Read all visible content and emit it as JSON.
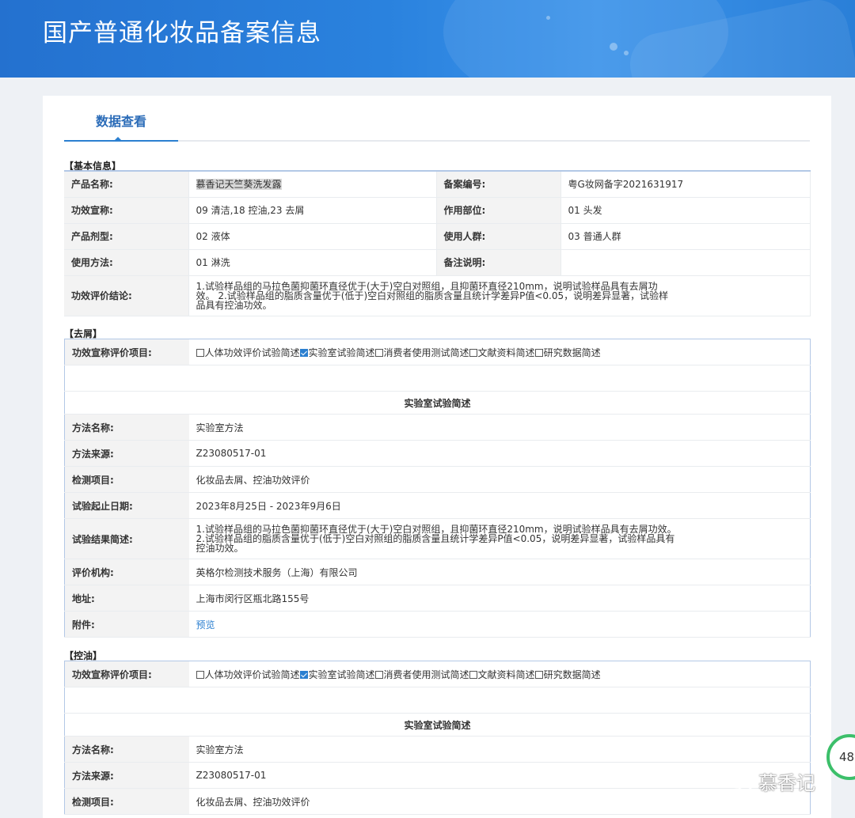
{
  "header": {
    "title": "国产普通化妆品备案信息"
  },
  "tabs": [
    {
      "label": "数据查看",
      "active": true
    }
  ],
  "basic": {
    "section_label": "【基本信息】",
    "rows": [
      {
        "l1": "产品名称:",
        "v1": "慕香记天竺葵洗发露",
        "l2": "备案编号:",
        "v2": "粤G妆网备字2021631917"
      },
      {
        "l1": "功效宣称:",
        "v1": "09 清洁,18 控油,23 去屑",
        "l2": "作用部位:",
        "v2": "01 头发"
      },
      {
        "l1": "产品剂型:",
        "v1": "02 液体",
        "l2": "使用人群:",
        "v2": "03 普通人群"
      },
      {
        "l1": "使用方法:",
        "v1": "01 淋洗",
        "l2": "备注说明:",
        "v2": ""
      }
    ],
    "conclusion_label": "功效评价结论:",
    "conclusion_value": "1.试验样品组的马拉色菌抑菌环直径优于(大于)空白对照组，且抑菌环直径210mm，说明试验样品具有去屑功效。 2.试验样品组的脂质含量优于(低于)空白对照组的脂质含量且统计学差异P值<0.05，说明差异显著，试验样品具有控油功效。"
  },
  "sections": [
    {
      "label": "【去屑】",
      "eval_label": "功效宣称评价项目:",
      "options": [
        {
          "text": "人体功效评价试验简述",
          "checked": false
        },
        {
          "text": "实验室试验简述",
          "checked": true
        },
        {
          "text": "消费者使用测试简述",
          "checked": false
        },
        {
          "text": "文献资料简述",
          "checked": false
        },
        {
          "text": "研究数据简述",
          "checked": false
        }
      ],
      "subheading": "实验室试验简述",
      "rows": [
        {
          "label": "方法名称:",
          "value": "实验室方法"
        },
        {
          "label": "方法来源:",
          "value": "Z23080517-01"
        },
        {
          "label": "检测项目:",
          "value": "化妆品去屑、控油功效评价"
        },
        {
          "label": "试验起止日期:",
          "value": "2023年8月25日 - 2023年9月6日"
        },
        {
          "label": "试验结果简述:",
          "value": "1.试验样品组的马拉色菌抑菌环直径优于(大于)空白对照组，且抑菌环直径210mm，说明试验样品具有去屑功效。2.试验样品组的脂质含量优于(低于)空白对照组的脂质含量且统计学差异P值<0.05，说明差异显著，试验样品具有控油功效。"
        },
        {
          "label": "评价机构:",
          "value": "英格尔检测技术服务（上海）有限公司"
        },
        {
          "label": "地址:",
          "value": "上海市闵行区瓶北路155号"
        },
        {
          "label": "附件:",
          "value": "预览"
        }
      ]
    },
    {
      "label": "【控油】",
      "eval_label": "功效宣称评价项目:",
      "options": [
        {
          "text": "人体功效评价试验简述",
          "checked": false
        },
        {
          "text": "实验室试验简述",
          "checked": true
        },
        {
          "text": "消费者使用测试简述",
          "checked": false
        },
        {
          "text": "文献资料简述",
          "checked": false
        },
        {
          "text": "研究数据简述",
          "checked": false
        }
      ],
      "subheading": "实验室试验简述",
      "rows": [
        {
          "label": "方法名称:",
          "value": "实验室方法"
        },
        {
          "label": "方法来源:",
          "value": "Z23080517-01"
        },
        {
          "label": "检测项目:",
          "value": "化妆品去屑、控油功效评价"
        }
      ]
    }
  ],
  "overlay": {
    "badge_text": "48",
    "watermark": "慕香记"
  },
  "colors": {
    "accent": "#2b7fd0",
    "banner": "#2a7fd8",
    "label_bg": "#f3f3f3",
    "border": "#b3c8e6"
  }
}
